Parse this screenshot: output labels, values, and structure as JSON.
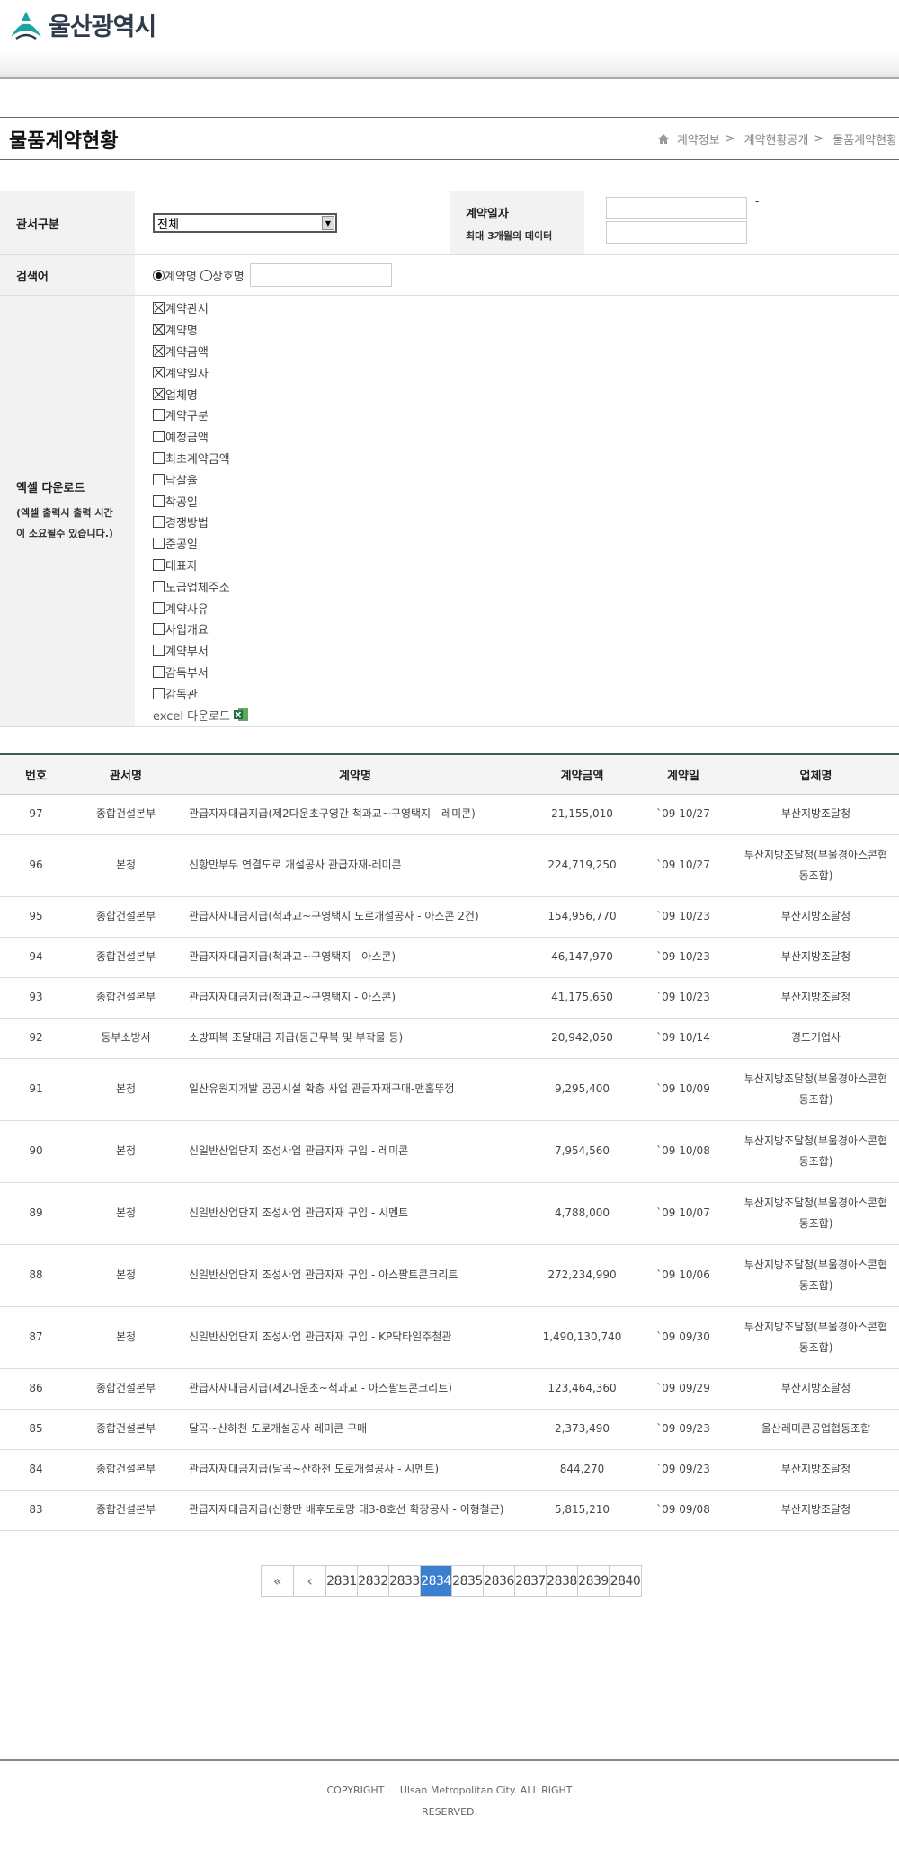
{
  "header": {
    "logo_text": "울산광역시"
  },
  "title": {
    "page_title": "물품계약현황",
    "breadcrumb": [
      "계약정보",
      "계약현황공개",
      "물품계약현황"
    ]
  },
  "form": {
    "office_label": "관서구분",
    "office_selected": "전체",
    "contract_date_label": "계약일자",
    "contract_date_note": "최대 3개월의 데이터",
    "date_sep": "-",
    "keyword_label": "검색어",
    "radio_options": [
      "계약명",
      "상호명"
    ],
    "excel_label": "엑셀 다운로드",
    "excel_note_1": "(엑셀 출력시 출력 시간",
    "excel_note_2": "이 소요될수 있습니다.)",
    "checkboxes": [
      {
        "label": "계약관서",
        "checked": true
      },
      {
        "label": "계약명",
        "checked": true
      },
      {
        "label": "계약금액",
        "checked": true
      },
      {
        "label": "계약일자",
        "checked": true
      },
      {
        "label": "업체명",
        "checked": true
      },
      {
        "label": "계약구분",
        "checked": false
      },
      {
        "label": "예정금액",
        "checked": false
      },
      {
        "label": "최초계약금액",
        "checked": false
      },
      {
        "label": "낙찰율",
        "checked": false
      },
      {
        "label": "착공일",
        "checked": false
      },
      {
        "label": "경쟁방법",
        "checked": false
      },
      {
        "label": "준공일",
        "checked": false
      },
      {
        "label": "대표자",
        "checked": false
      },
      {
        "label": "도급업체주소",
        "checked": false
      },
      {
        "label": "계약사유",
        "checked": false
      },
      {
        "label": "사업개요",
        "checked": false
      },
      {
        "label": "계약부서",
        "checked": false
      },
      {
        "label": "감독부서",
        "checked": false
      },
      {
        "label": "감독관",
        "checked": false
      }
    ],
    "excel_download": "excel 다운로드"
  },
  "table": {
    "headers": [
      "번호",
      "관서명",
      "계약명",
      "계약금액",
      "계약일",
      "업체명"
    ],
    "rows": [
      {
        "no": "97",
        "office": "종합건설본부",
        "name": "관급자재대금지급(제2다운초구영간 척과교~구영택지 - 레미콘)",
        "amount": "21,155,010",
        "date": "`09 10/27",
        "vendor": "부산지방조달청",
        "tall": false
      },
      {
        "no": "96",
        "office": "본청",
        "name": "신항만부두 연결도로 개설공사 관급자재-레미콘",
        "amount": "224,719,250",
        "date": "`09 10/27",
        "vendor": "부산지방조달청(부울경아스콘협동조합)",
        "tall": true
      },
      {
        "no": "95",
        "office": "종합건설본부",
        "name": "관급자재대금지급(척과교~구영택지 도로개설공사 - 아스콘 2건)",
        "amount": "154,956,770",
        "date": "`09 10/23",
        "vendor": "부산지방조달청",
        "tall": false
      },
      {
        "no": "94",
        "office": "종합건설본부",
        "name": "관급자재대금지급(척과교~구영택지 - 아스콘)",
        "amount": "46,147,970",
        "date": "`09 10/23",
        "vendor": "부산지방조달청",
        "tall": false
      },
      {
        "no": "93",
        "office": "종합건설본부",
        "name": "관급자재대금지급(척과교~구영택지 - 아스콘)",
        "amount": "41,175,650",
        "date": "`09 10/23",
        "vendor": "부산지방조달청",
        "tall": false
      },
      {
        "no": "92",
        "office": "동부소방서",
        "name": "소방피복 조달대금 지급(동근무복 및 부착물 등)",
        "amount": "20,942,050",
        "date": "`09 10/14",
        "vendor": "경도기업사",
        "tall": false
      },
      {
        "no": "91",
        "office": "본청",
        "name": "일산유원지개발 공공시설 확충 사업 관급자재구매-맨홀뚜껑",
        "amount": "9,295,400",
        "date": "`09 10/09",
        "vendor": "부산지방조달청(부울경아스콘협동조합)",
        "tall": true
      },
      {
        "no": "90",
        "office": "본청",
        "name": "신일반산업단지 조성사업 관급자재 구입 - 레미콘",
        "amount": "7,954,560",
        "date": "`09 10/08",
        "vendor": "부산지방조달청(부울경아스콘협동조합)",
        "tall": true
      },
      {
        "no": "89",
        "office": "본청",
        "name": "신일반산업단지 조성사업 관급자재 구입 - 시멘트",
        "amount": "4,788,000",
        "date": "`09 10/07",
        "vendor": "부산지방조달청(부울경아스콘협동조합)",
        "tall": true
      },
      {
        "no": "88",
        "office": "본청",
        "name": "신일반산업단지 조성사업 관급자재 구입 - 아스팔트콘크리트",
        "amount": "272,234,990",
        "date": "`09 10/06",
        "vendor": "부산지방조달청(부울경아스콘협동조합)",
        "tall": true
      },
      {
        "no": "87",
        "office": "본청",
        "name": "신일반산업단지 조성사업 관급자재 구입 - KP닥타일주철관",
        "amount": "1,490,130,740",
        "date": "`09 09/30",
        "vendor": "부산지방조달청(부울경아스콘협동조합)",
        "tall": true
      },
      {
        "no": "86",
        "office": "종합건설본부",
        "name": "관급자재대금지급(제2다운초~척과교 - 아스팔트콘크리트)",
        "amount": "123,464,360",
        "date": "`09 09/29",
        "vendor": "부산지방조달청",
        "tall": false
      },
      {
        "no": "85",
        "office": "종합건설본부",
        "name": "달곡~산하천 도로개설공사 레미콘 구매",
        "amount": "2,373,490",
        "date": "`09 09/23",
        "vendor": "울산레미콘공업협동조합",
        "tall": false
      },
      {
        "no": "84",
        "office": "종합건설본부",
        "name": "관급자재대금지급(달곡~산하천 도로개설공사 - 시멘트)",
        "amount": "844,270",
        "date": "`09 09/23",
        "vendor": "부산지방조달청",
        "tall": false
      },
      {
        "no": "83",
        "office": "종합건설본부",
        "name": "관급자재대금지급(신항만 배후도로망 대3-8호선 확장공사 - 이형철근)",
        "amount": "5,815,210",
        "date": "`09 09/08",
        "vendor": "부산지방조달청",
        "tall": false
      }
    ]
  },
  "pagination": {
    "first": "«",
    "prev": "‹",
    "pages": [
      "2831",
      "2832",
      "2833",
      "2834",
      "2835",
      "2836",
      "2837",
      "2838",
      "2839",
      "2840"
    ],
    "current": "2834"
  },
  "footer": {
    "line1": "COPYRIGHT     Ulsan Metropolitan City. ALL RIGHT",
    "line2": "RESERVED."
  }
}
